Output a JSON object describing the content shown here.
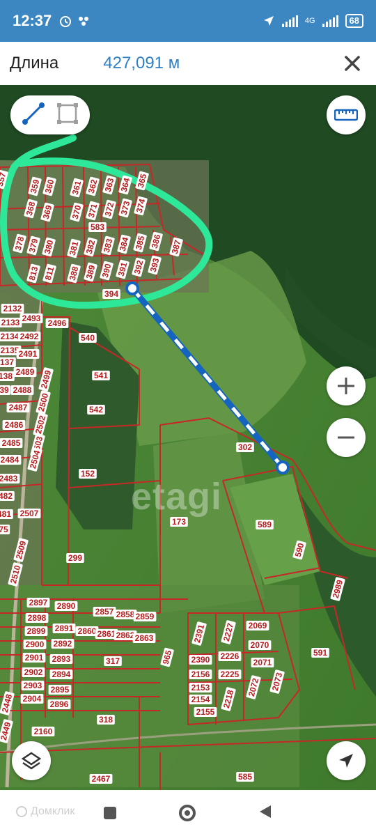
{
  "status": {
    "time": "12:37",
    "battery": "68",
    "network": "4G"
  },
  "topbar": {
    "label": "Длина",
    "value": "427,091 м"
  },
  "map": {
    "watermark": "etagi",
    "plots": [
      {
        "n": "357"
      },
      {
        "n": "359"
      },
      {
        "n": "360"
      },
      {
        "n": "361"
      },
      {
        "n": "362"
      },
      {
        "n": "363"
      },
      {
        "n": "364"
      },
      {
        "n": "365"
      },
      {
        "n": "368"
      },
      {
        "n": "369"
      },
      {
        "n": "370"
      },
      {
        "n": "371"
      },
      {
        "n": "372"
      },
      {
        "n": "373"
      },
      {
        "n": "374"
      },
      {
        "n": "583"
      },
      {
        "n": "378"
      },
      {
        "n": "379"
      },
      {
        "n": "380"
      },
      {
        "n": "381"
      },
      {
        "n": "382"
      },
      {
        "n": "383"
      },
      {
        "n": "384"
      },
      {
        "n": "385"
      },
      {
        "n": "386"
      },
      {
        "n": "387"
      },
      {
        "n": "813"
      },
      {
        "n": "811"
      },
      {
        "n": "388"
      },
      {
        "n": "389"
      },
      {
        "n": "390"
      },
      {
        "n": "391"
      },
      {
        "n": "392"
      },
      {
        "n": "393"
      },
      {
        "n": "394"
      },
      {
        "n": "2132"
      },
      {
        "n": "2133"
      },
      {
        "n": "2493"
      },
      {
        "n": "2496"
      },
      {
        "n": "2134"
      },
      {
        "n": "2492"
      },
      {
        "n": "2135"
      },
      {
        "n": "2491"
      },
      {
        "n": "137"
      },
      {
        "n": "2489"
      },
      {
        "n": "138"
      },
      {
        "n": "2499"
      },
      {
        "n": "39"
      },
      {
        "n": "2488"
      },
      {
        "n": "2500"
      },
      {
        "n": "2487"
      },
      {
        "n": "2502"
      },
      {
        "n": "2486"
      },
      {
        "n": "2503"
      },
      {
        "n": "2485"
      },
      {
        "n": "2504"
      },
      {
        "n": "2484"
      },
      {
        "n": "2483"
      },
      {
        "n": "482"
      },
      {
        "n": "481"
      },
      {
        "n": "2507"
      },
      {
        "n": "75"
      },
      {
        "n": "2509"
      },
      {
        "n": "2510"
      },
      {
        "n": "540"
      },
      {
        "n": "541"
      },
      {
        "n": "542"
      },
      {
        "n": "152"
      },
      {
        "n": "173"
      },
      {
        "n": "299"
      },
      {
        "n": "302"
      },
      {
        "n": "589"
      },
      {
        "n": "590"
      },
      {
        "n": "2989"
      },
      {
        "n": "591"
      },
      {
        "n": "2897"
      },
      {
        "n": "2890"
      },
      {
        "n": "2857"
      },
      {
        "n": "2858"
      },
      {
        "n": "2859"
      },
      {
        "n": "2898"
      },
      {
        "n": "2899"
      },
      {
        "n": "2891"
      },
      {
        "n": "2860"
      },
      {
        "n": "2861"
      },
      {
        "n": "2862"
      },
      {
        "n": "2863"
      },
      {
        "n": "2900"
      },
      {
        "n": "2892"
      },
      {
        "n": "2901"
      },
      {
        "n": "2893"
      },
      {
        "n": "317"
      },
      {
        "n": "965"
      },
      {
        "n": "2902"
      },
      {
        "n": "2894"
      },
      {
        "n": "2903"
      },
      {
        "n": "2895"
      },
      {
        "n": "2904"
      },
      {
        "n": "2896"
      },
      {
        "n": "2391"
      },
      {
        "n": "2227"
      },
      {
        "n": "2069"
      },
      {
        "n": "2070"
      },
      {
        "n": "2390"
      },
      {
        "n": "2226"
      },
      {
        "n": "2071"
      },
      {
        "n": "2156"
      },
      {
        "n": "2225"
      },
      {
        "n": "2153"
      },
      {
        "n": "2072"
      },
      {
        "n": "2073"
      },
      {
        "n": "2154"
      },
      {
        "n": "2218"
      },
      {
        "n": "2155"
      },
      {
        "n": "2448"
      },
      {
        "n": "2449"
      },
      {
        "n": "2160"
      },
      {
        "n": "318"
      },
      {
        "n": "2467"
      },
      {
        "n": "585"
      }
    ]
  },
  "navbar": {
    "brand": "Домклик"
  },
  "colors": {
    "accent": "#2f7fc4",
    "route": "#1565c0",
    "highlight": "#2ee89a",
    "plotline": "#c62828"
  }
}
